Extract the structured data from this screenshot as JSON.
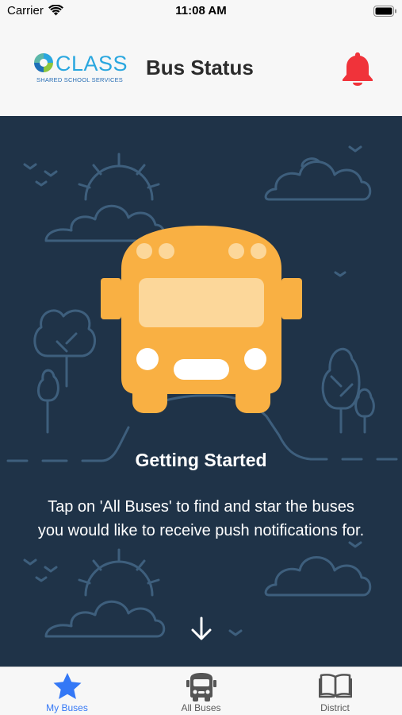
{
  "status_bar": {
    "carrier": "Carrier",
    "time": "11:08 AM"
  },
  "header": {
    "logo": {
      "word": "CLASS",
      "tagline": "SHARED SCHOOL SERVICES"
    },
    "title": "Bus Status",
    "notifications_icon": "bell-icon",
    "notifications_color": "#f0333a"
  },
  "onboarding": {
    "illustration": "school-bus-icon",
    "heading": "Getting Started",
    "message": "Tap on 'All Buses' to find and star the buses you would like to receive push notifications for.",
    "scroll_icon": "arrow-down-icon"
  },
  "tabs": [
    {
      "label": "My Buses",
      "icon": "star-icon",
      "active": true
    },
    {
      "label": "All Buses",
      "icon": "bus-icon",
      "active": false
    },
    {
      "label": "District",
      "icon": "book-icon",
      "active": false
    }
  ],
  "colors": {
    "background": "#1f3348",
    "bus": "#f9b043",
    "accent": "#3478f6",
    "alert": "#f0333a"
  }
}
